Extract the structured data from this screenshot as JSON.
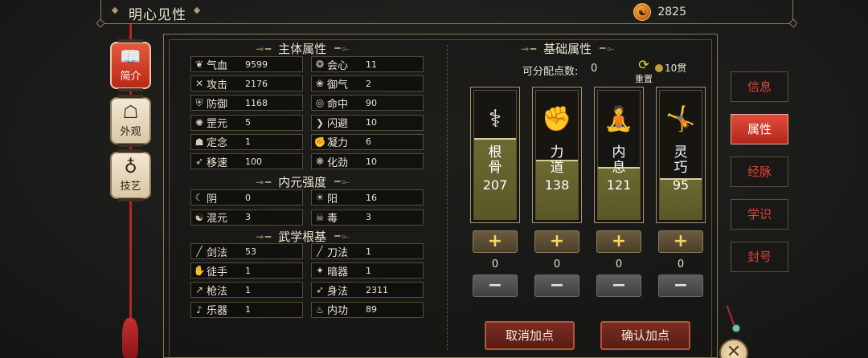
{
  "header": {
    "title": "明心见性",
    "currency_icon": "yinyang-coin-icon",
    "currency_value": "2825"
  },
  "left_nav": [
    {
      "label": "简介",
      "icon": "book-icon",
      "active": true
    },
    {
      "label": "外观",
      "icon": "portrait-icon",
      "active": false
    },
    {
      "label": "技艺",
      "icon": "pipa-icon",
      "active": false
    }
  ],
  "sections": {
    "main": "主体属性",
    "inner": "内元强度",
    "martial": "武学根基",
    "base": "基础属性"
  },
  "main_stats": [
    {
      "icon": "❦",
      "label": "气血",
      "value": "9599"
    },
    {
      "icon": "❂",
      "label": "会心",
      "value": "11"
    },
    {
      "icon": "✕",
      "label": "攻击",
      "value": "2176"
    },
    {
      "icon": "❀",
      "label": "御气",
      "value": "2"
    },
    {
      "icon": "⛨",
      "label": "防御",
      "value": "1168"
    },
    {
      "icon": "◎",
      "label": "命中",
      "value": "90"
    },
    {
      "icon": "✺",
      "label": "罡元",
      "value": "5"
    },
    {
      "icon": "❯",
      "label": "闪避",
      "value": "10"
    },
    {
      "icon": "☗",
      "label": "定念",
      "value": "1"
    },
    {
      "icon": "✊",
      "label": "凝力",
      "value": "6"
    },
    {
      "icon": "➶",
      "label": "移速",
      "value": "100"
    },
    {
      "icon": "❋",
      "label": "化劲",
      "value": "10"
    }
  ],
  "inner_stats": [
    {
      "icon": "☾",
      "label": "阴",
      "value": "0"
    },
    {
      "icon": "☀",
      "label": "阳",
      "value": "16"
    },
    {
      "icon": "☯",
      "label": "混元",
      "value": "3"
    },
    {
      "icon": "☠",
      "label": "毒",
      "value": "3"
    }
  ],
  "martial_stats": [
    {
      "icon": "╱",
      "label": "剑法",
      "value": "53"
    },
    {
      "icon": "╱",
      "label": "刀法",
      "value": "1"
    },
    {
      "icon": "✋",
      "label": "徒手",
      "value": "1"
    },
    {
      "icon": "✦",
      "label": "暗器",
      "value": "1"
    },
    {
      "icon": "↗",
      "label": "枪法",
      "value": "1"
    },
    {
      "icon": "➶",
      "label": "身法",
      "value": "2311"
    },
    {
      "icon": "♪",
      "label": "乐器",
      "value": "1"
    },
    {
      "icon": "♨",
      "label": "内功",
      "value": "89"
    }
  ],
  "points": {
    "label": "可分配点数:",
    "value": "0",
    "reset_label": "重置",
    "cost": "10贯"
  },
  "attributes": [
    {
      "name_1": "根",
      "name_2": "骨",
      "value": "207",
      "icon": "bamboo-icon",
      "glyph": "⚕",
      "fill": 0.62,
      "alloc": "0"
    },
    {
      "name_1": "力",
      "name_2": "道",
      "value": "138",
      "icon": "fist-icon",
      "glyph": "✊",
      "fill": 0.46,
      "alloc": "0"
    },
    {
      "name_1": "内",
      "name_2": "息",
      "value": "121",
      "icon": "meditation-icon",
      "glyph": "🧘",
      "fill": 0.4,
      "alloc": "0"
    },
    {
      "name_1": "灵",
      "name_2": "巧",
      "value": "95",
      "icon": "kick-icon",
      "glyph": "🤸",
      "fill": 0.32,
      "alloc": "0"
    }
  ],
  "buttons": {
    "plus": "+",
    "minus": "−",
    "cancel": "取消加点",
    "confirm": "确认加点"
  },
  "right_tabs": [
    {
      "label": "信息",
      "active": false
    },
    {
      "label": "属性",
      "active": true
    },
    {
      "label": "经脉",
      "active": false
    },
    {
      "label": "学识",
      "active": false
    },
    {
      "label": "封号",
      "active": false
    }
  ],
  "close_glyph": "✕"
}
